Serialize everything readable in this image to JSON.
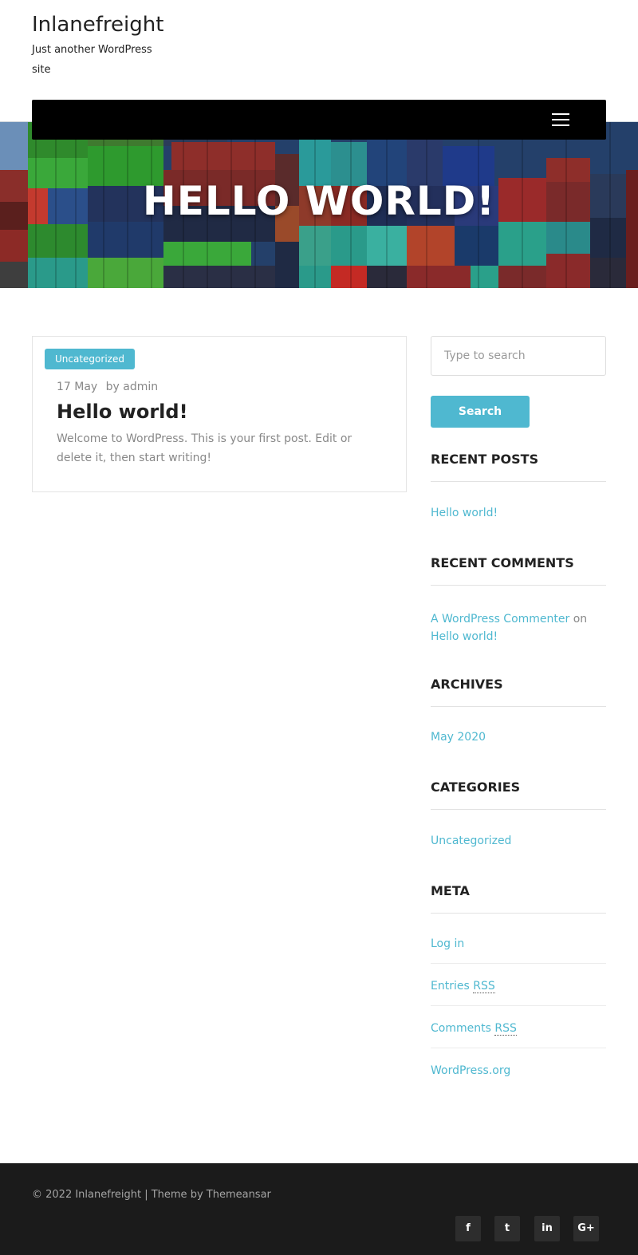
{
  "site": {
    "title": "Inlanefreight",
    "description": "Just another WordPress site"
  },
  "hero": {
    "title": "HELLO WORLD!"
  },
  "post": {
    "category": "Uncategorized",
    "date": "17 May",
    "author": "by admin",
    "title": "Hello world!",
    "excerpt": "Welcome to WordPress. This is your first post. Edit or delete it, then start writing!"
  },
  "search": {
    "placeholder": "Type to search",
    "button_label": "Search"
  },
  "sidebar": {
    "recent_posts": {
      "title": "RECENT POSTS",
      "items": [
        "Hello world!"
      ]
    },
    "recent_comments": {
      "title": "RECENT COMMENTS",
      "commenter": "A WordPress Commenter",
      "joiner": "on",
      "post": "Hello world!"
    },
    "archives": {
      "title": "ARCHIVES",
      "items": [
        "May 2020"
      ]
    },
    "categories": {
      "title": "CATEGORIES",
      "items": [
        "Uncategorized"
      ]
    },
    "meta": {
      "title": "META",
      "login": "Log in",
      "entries": "Entries",
      "comments": "Comments",
      "rss": "RSS",
      "wordpress_org": "WordPress.org"
    }
  },
  "footer": {
    "copyright": "© 2022 Inlanefreight | Theme by Themeansar",
    "social": {
      "facebook": "f",
      "twitter": "t",
      "linkedin": "in",
      "googleplus": "G+"
    }
  },
  "colors": {
    "accent": "#4fb8d0",
    "navbar": "#000000",
    "footer": "#1b1b1b"
  }
}
